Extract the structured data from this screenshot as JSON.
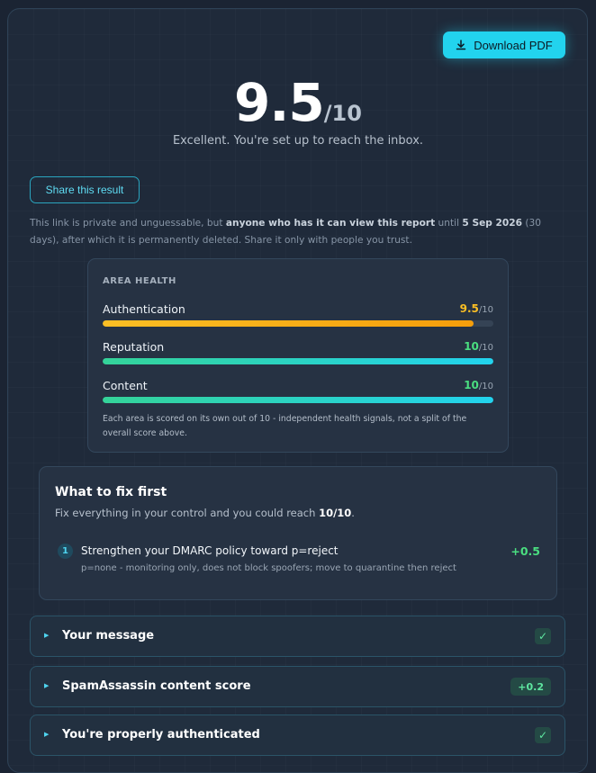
{
  "header": {
    "download_label": "Download PDF",
    "download_icon": "download-icon"
  },
  "score": {
    "value": "9.5",
    "denominator": "/10",
    "summary": "Excellent. You're set up to reach the inbox."
  },
  "share": {
    "button_label": "Share this result",
    "note_prefix": "This link is private and unguessable, but ",
    "note_bold1": "anyone who has it can view this report",
    "note_mid": " until ",
    "note_bold2": "5 Sep 2026",
    "note_suffix": " (30 days), after which it is permanently deleted. Share it only with people you trust."
  },
  "area_health": {
    "title": "AREA HEALTH",
    "rows": [
      {
        "label": "Authentication",
        "score": "9.5",
        "max": "/10",
        "fraction": 0.95,
        "value_color": "#fbbf24",
        "bar_colors": [
          "#fbbf24",
          "#f59e0b"
        ]
      },
      {
        "label": "Reputation",
        "score": "10",
        "max": "/10",
        "fraction": 1.0,
        "value_color": "#4ade80",
        "bar_colors": [
          "#34d399",
          "#22d3ee"
        ]
      },
      {
        "label": "Content",
        "score": "10",
        "max": "/10",
        "fraction": 1.0,
        "value_color": "#4ade80",
        "bar_colors": [
          "#34d399",
          "#22d3ee"
        ]
      }
    ],
    "note": "Each area is scored on its own out of 10 - independent health signals, not a split of the overall score above."
  },
  "fix_first": {
    "title": "What to fix first",
    "subtitle_prefix": "Fix everything in your control and you could reach ",
    "subtitle_bold": "10/10",
    "subtitle_suffix": ".",
    "items": [
      {
        "number": "1",
        "title": "Strengthen your DMARC policy toward p=reject",
        "description": "p=none - monitoring only, does not block spoofers; move to quarantine then reject",
        "gain": "+0.5"
      }
    ]
  },
  "sections": [
    {
      "label": "Your message",
      "status": "check",
      "status_text": "✓"
    },
    {
      "label": "SpamAssassin content score",
      "status": "badge",
      "status_text": "+0.2"
    },
    {
      "label": "You're properly authenticated",
      "status": "check",
      "status_text": "✓"
    }
  ],
  "colors": {
    "accent": "#22d3ee",
    "success": "#4ade80",
    "warning": "#fbbf24",
    "background": "#1b2433"
  }
}
